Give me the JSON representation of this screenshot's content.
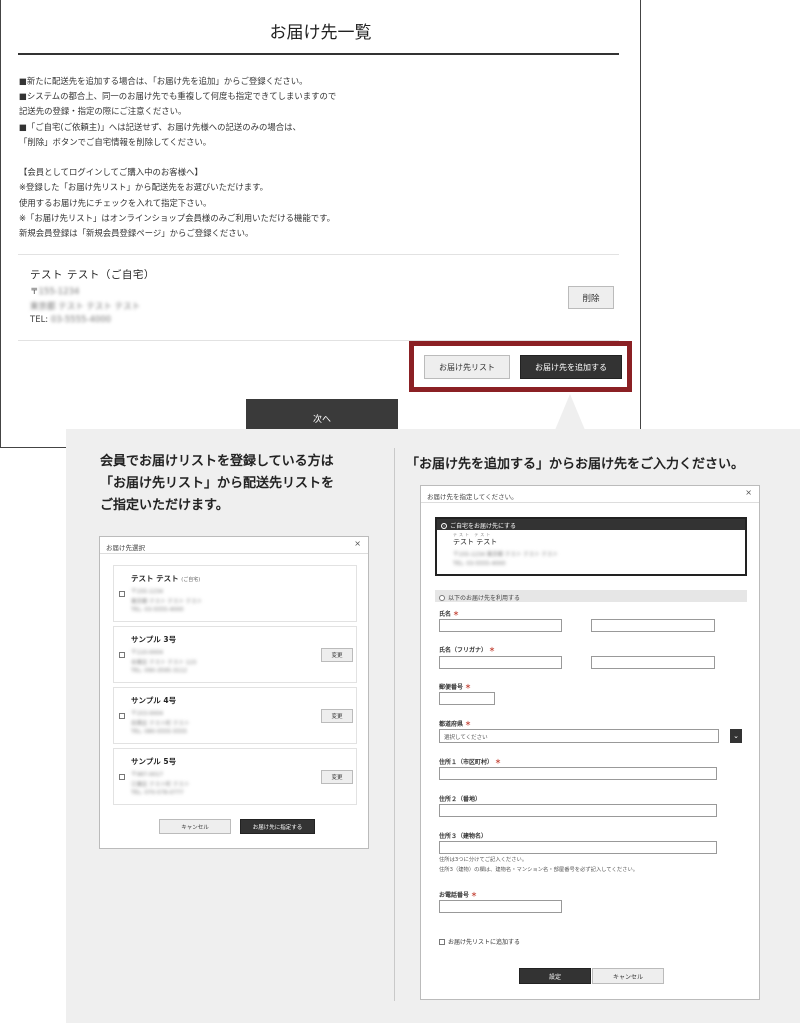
{
  "page": {
    "title": "お届け先一覧",
    "notice": "■新たに配送先を追加する場合は、「お届け先を追加」からご登録ください。\n■システムの都合上、同一のお届け先でも重複して何度も指定できてしまいますので\n記送先の登録・指定の際にご注意ください。\n■「ご自宅(ご依頼主)」へは記送せず、お届け先様への記送のみの場合は、\n「削除」ボタンでご自宅情報を削除してください。\n\n【会員としてログインしてご購入中のお客様へ】\n※登録した「お届け先リスト」から配送先をお選びいただけます。\n使用するお届け先にチェックを入れて指定下さい。\n※「お届け先リスト」はオンラインショップ会員様のみご利用いただける機能です。\n新規会員登録は「新規会員登録ページ」からご登録ください。"
  },
  "address": {
    "name": "テスト テスト（ご自宅）",
    "postal_prefix": "〒",
    "postal": "155-1234",
    "street": "東京都 テスト テスト テスト",
    "tel_label": "TEL:",
    "tel": "03-5555-4000",
    "delete_label": "削除"
  },
  "actions": {
    "list_label": "お届け先リスト",
    "add_label": "お届け先を追加する",
    "next_label": "次へ"
  },
  "explain": {
    "left_heading": "会員でお届けリストを登録している方は\n「お届け先リスト」から配送先リストを\nご指定いただけます。",
    "right_heading": "「お届け先を追加する」からお届け先をご入力ください。"
  },
  "list_modal": {
    "title": "お届け先選択",
    "close": "×",
    "entries": [
      {
        "name": "テスト テスト",
        "tag": "(ご自宅)",
        "postal": "〒155-1234",
        "addr": "東京都 テスト テスト テスト",
        "tel": "TEL: 03-5555-4000",
        "has_change": false
      },
      {
        "name": "サンプル 3号",
        "tag": "",
        "postal": "〒110-0004",
        "addr": "台東区 テスト テスト 123",
        "tel": "TEL: 090-3595-3112",
        "has_change": true
      },
      {
        "name": "サンプル 4号",
        "tag": "",
        "postal": "〒153-0004",
        "addr": "目黒区 テスト町 テスト",
        "tel": "TEL: 080-5555-5555",
        "has_change": true
      },
      {
        "name": "サンプル 5号",
        "tag": "",
        "postal": "〒987-0017",
        "addr": "江東区 テスト町 テスト",
        "tel": "TEL: 070-578-0777",
        "has_change": true
      }
    ],
    "change_label": "変更",
    "cancel_label": "キャンセル",
    "ok_label": "お届け先に指定する"
  },
  "add_modal": {
    "title": "お届け先を指定してください。",
    "close": "×",
    "home_option": "ご自宅をお届け先にする",
    "home_ruby": "テスト テスト",
    "home_name": "テスト テスト",
    "home_postal": "〒155-1234 東京都 テスト テスト テスト",
    "home_tel": "TEL: 03-5555-4000",
    "other_option": "以下のお届け先を利用する",
    "required_mark": "＊",
    "fields": {
      "name": "氏名",
      "kana": "氏名（フリガナ）",
      "postal": "郵便番号",
      "pref": "都道府県",
      "pref_placeholder": "選択してください",
      "addr1": "住所１（市区町村）",
      "addr2": "住所２（番地）",
      "addr3": "住所３（建物名）",
      "addr_note": "住所は3つに分けてご記入ください。\n住所3（建物）の欄は、建物名・マンション名・部屋番号を必ず記入してください。",
      "tel": "お電話番号"
    },
    "add_to_list": "お届け先リストに追加する",
    "ok_label": "設定",
    "cancel_label": "キャンセル"
  },
  "colors": {
    "highlight": "#8b2024",
    "dark_button": "#333333",
    "panel_bg": "#efefef"
  }
}
